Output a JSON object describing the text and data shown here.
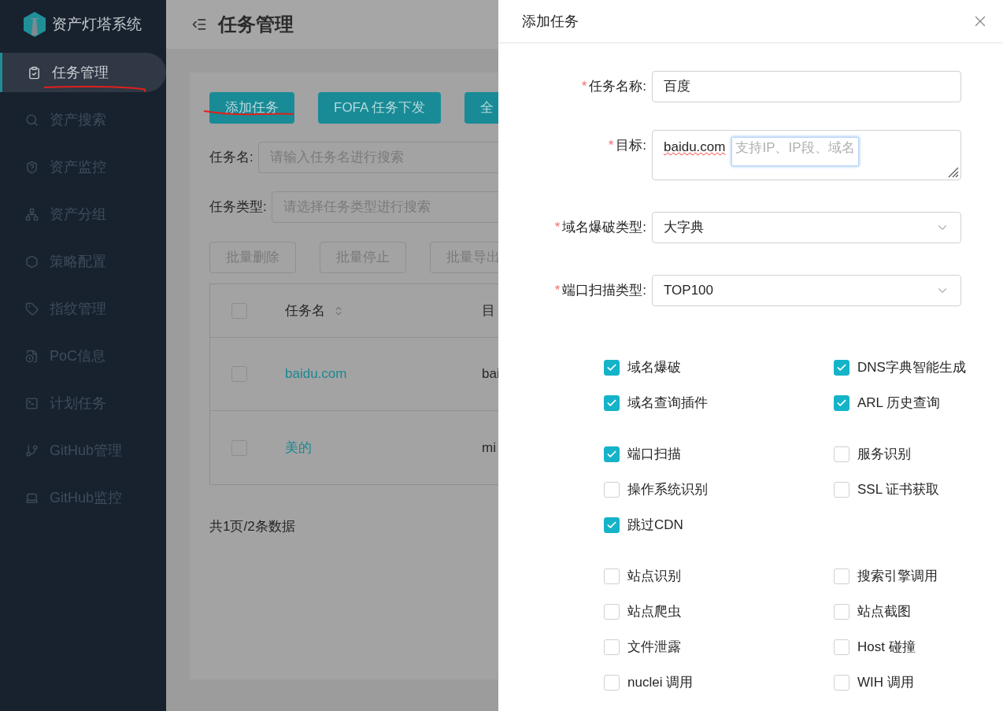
{
  "app": {
    "title": "资产灯塔系统"
  },
  "sidebar": {
    "items": [
      {
        "label": "任务管理",
        "selected": true
      },
      {
        "label": "资产搜索",
        "selected": false
      },
      {
        "label": "资产监控",
        "selected": false
      },
      {
        "label": "资产分组",
        "selected": false
      },
      {
        "label": "策略配置",
        "selected": false
      },
      {
        "label": "指纹管理",
        "selected": false
      },
      {
        "label": "PoC信息",
        "selected": false
      },
      {
        "label": "计划任务",
        "selected": false
      },
      {
        "label": "GitHub管理",
        "selected": false
      },
      {
        "label": "GitHub监控",
        "selected": false
      }
    ]
  },
  "page": {
    "title": "任务管理",
    "actions": [
      "添加任务",
      "FOFA 任务下发",
      "全"
    ],
    "filters": [
      {
        "label": "任务名:",
        "placeholder": "请输入任务名进行搜索"
      },
      {
        "label": "任务类型:",
        "placeholder": "请选择任务类型进行搜索"
      }
    ],
    "batch_actions": [
      {
        "label": "批量删除",
        "disabled": true
      },
      {
        "label": "批量停止",
        "disabled": true
      },
      {
        "label": "批量导出",
        "disabled": true
      }
    ],
    "table": {
      "header_checked": false,
      "columns": [
        "任务名",
        "目"
      ],
      "rows": [
        {
          "name": "baidu.com",
          "target": "bai",
          "checked": false
        },
        {
          "name": "美的",
          "target": "mi",
          "checked": false
        }
      ]
    },
    "footer": "共1页/2条数据"
  },
  "drawer": {
    "title": "添加任务",
    "fields": [
      {
        "kind": "input",
        "required_mark": "*",
        "label": "任务名称:",
        "value": "百度"
      },
      {
        "kind": "textarea",
        "required_mark": "*",
        "label": "目标:",
        "value": "baidu.com",
        "hint": "支持IP、IP段、域名"
      },
      {
        "kind": "select",
        "required_mark": "*",
        "label": "域名爆破类型:",
        "value": "大字典"
      },
      {
        "kind": "select",
        "required_mark": "*",
        "label": "端口扫描类型:",
        "value": "TOP100"
      }
    ],
    "option_groups": [
      [
        {
          "label": "域名爆破",
          "checked": true
        },
        {
          "label": "DNS字典智能生成",
          "checked": true
        },
        {
          "label": "域名查询插件",
          "checked": true
        },
        {
          "label": "ARL 历史查询",
          "checked": true
        }
      ],
      [
        {
          "label": "端口扫描",
          "checked": true
        },
        {
          "label": "服务识别",
          "checked": false
        },
        {
          "label": "操作系统识别",
          "checked": false
        },
        {
          "label": "SSL 证书获取",
          "checked": false
        },
        {
          "label": "跳过CDN",
          "checked": true
        }
      ],
      [
        {
          "label": "站点识别",
          "checked": false
        },
        {
          "label": "搜索引擎调用",
          "checked": false
        },
        {
          "label": "站点爬虫",
          "checked": false
        },
        {
          "label": "站点截图",
          "checked": false
        },
        {
          "label": "文件泄露",
          "checked": false
        },
        {
          "label": "Host 碰撞",
          "checked": false
        },
        {
          "label": "nuclei 调用",
          "checked": false
        },
        {
          "label": "WIH 调用",
          "checked": false
        }
      ]
    ]
  }
}
